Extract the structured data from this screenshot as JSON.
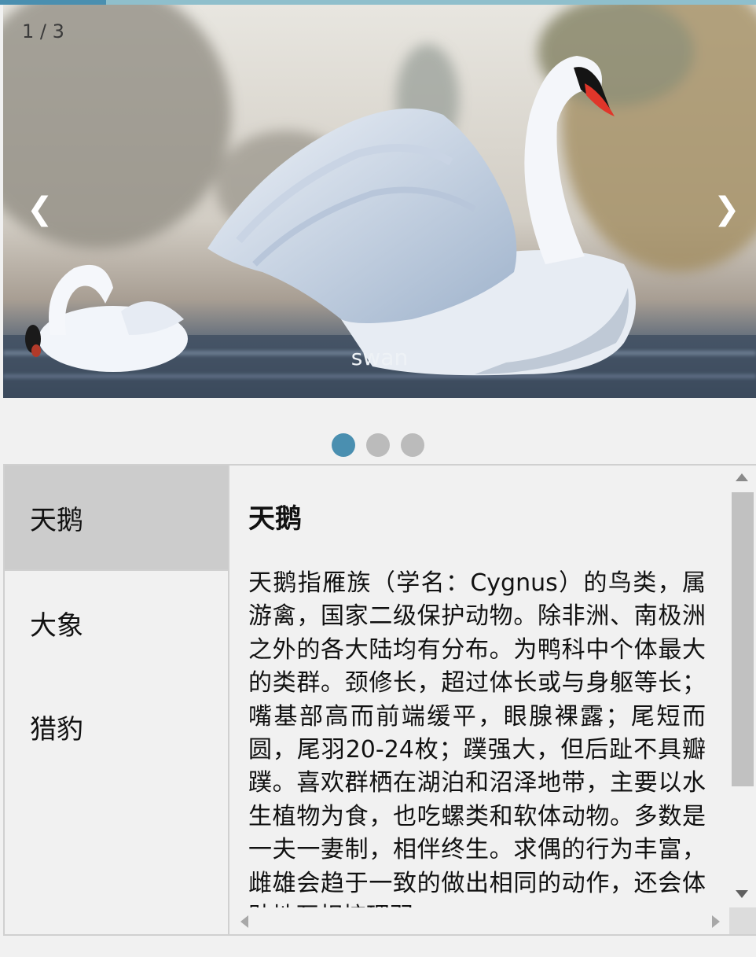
{
  "slideshow": {
    "counter": "1 / 3",
    "caption": "swan",
    "prev_arrow": "❮",
    "next_arrow": "❯",
    "progress_fraction": 0.14,
    "slides": [
      "slide-1",
      "slide-2",
      "slide-3"
    ],
    "active_index": 0
  },
  "tabs": [
    {
      "label": "天鹅",
      "active": true
    },
    {
      "label": "大象",
      "active": false
    },
    {
      "label": "猎豹",
      "active": false
    }
  ],
  "content": {
    "title": "天鹅",
    "body": "天鹅指雁族（学名：Cygnus）的鸟类，属游禽，国家二级保护动物。除非洲、南极洲之外的各大陆均有分布。为鸭科中个体最大的类群。颈修长，超过体长或与身躯等长；嘴基部高而前端缓平，眼腺裸露；尾短而圆，尾羽20-24枚；蹼强大，但后趾不具瓣蹼。喜欢群栖在湖泊和沼泽地带，主要以水生植物为食，也吃螺类和软体动物。多数是一夫一妻制，相伴终生。求偶的行为丰富，雌雄会趋于一致的做出相同的动作，还会体贴地互相梳理羽"
  },
  "colors": {
    "accent": "#4a8fb0",
    "progress_track": "#8fbfcc",
    "dot_inactive": "#bbbbbb",
    "tab_active": "#cccccc",
    "background": "#f1f1f1"
  }
}
